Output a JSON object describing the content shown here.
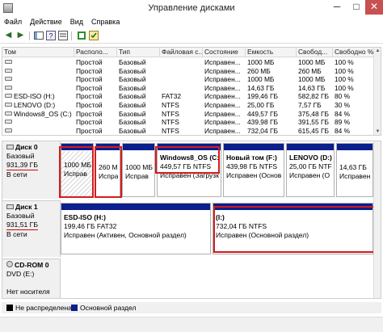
{
  "window": {
    "title": "Управление дисками",
    "min": "─",
    "max": "□",
    "close": "✕"
  },
  "menu": [
    "Файл",
    "Действие",
    "Вид",
    "Справка"
  ],
  "toolbar": {
    "back": "◀",
    "forward": "▶"
  },
  "table": {
    "headers": [
      "Том",
      "Располо...",
      "Тип",
      "Файловая с...",
      "Состояние",
      "Емкость",
      "Свобод...",
      "Свободно %"
    ],
    "rows": [
      [
        "",
        "Простой",
        "Базовый",
        "",
        "Исправен...",
        "1000 МБ",
        "1000 МБ",
        "100 %"
      ],
      [
        "",
        "Простой",
        "Базовый",
        "",
        "Исправен...",
        "260 МБ",
        "260 МБ",
        "100 %"
      ],
      [
        "",
        "Простой",
        "Базовый",
        "",
        "Исправен...",
        "1000 МБ",
        "1000 МБ",
        "100 %"
      ],
      [
        "",
        "Простой",
        "Базовый",
        "",
        "Исправен...",
        "14,63 ГБ",
        "14,63 ГБ",
        "100 %"
      ],
      [
        "ESD-ISO (H:)",
        "Простой",
        "Базовый",
        "FAT32",
        "Исправен...",
        "199,46 ГБ",
        "582,82 ГБ",
        "80 %"
      ],
      [
        "LENOVO (D:)",
        "Простой",
        "Базовый",
        "NTFS",
        "Исправен...",
        "25,00 ГБ",
        "7,57 ГБ",
        "30 %"
      ],
      [
        "Windows8_OS (C:)",
        "Простой",
        "Базовый",
        "NTFS",
        "Исправен...",
        "449,57 ГБ",
        "375,48 ГБ",
        "84 %"
      ],
      [
        "",
        "Простой",
        "Базовый",
        "NTFS",
        "Исправен...",
        "439,98 ГБ",
        "391,55 ГБ",
        "89 %"
      ],
      [
        "",
        "Простой",
        "Базовый",
        "NTFS",
        "Исправен...",
        "732,04 ГБ",
        "615,45 ГБ",
        "84 %"
      ]
    ]
  },
  "disks": [
    {
      "name": "Диск 0",
      "type": "Базовый",
      "size": "931,39 ГБ",
      "status": "В сети",
      "partitions": [
        {
          "line1": "1000 МБ",
          "line2": "Исправ"
        },
        {
          "line1": "260 МІ",
          "line2": "Испра"
        },
        {
          "line1": "1000 МБ",
          "line2": "Исправ"
        },
        {
          "title": "Windows8_OS  (C:)",
          "line1": "449,57 ГБ NTFS",
          "line2": "Исправен (Загрузк"
        },
        {
          "title": "Новый том  (F:)",
          "line1": "439,98 ГБ NTFS",
          "line2": "Исправен (Основ"
        },
        {
          "title": "LENOVO  (D:)",
          "line1": "25,00 ГБ NTFS",
          "line2": "Исправен (О"
        },
        {
          "line1": "14,63 ГБ",
          "line2": "Исправен"
        }
      ]
    },
    {
      "name": "Диск 1",
      "type": "Базовый",
      "size": "931,51 ГБ",
      "status": "В сети",
      "partitions": [
        {
          "title": "ESD-ISO  (H:)",
          "line1": "199,46 ГБ FAT32",
          "line2": "Исправен (Активен, Основной раздел)"
        },
        {
          "title": "(I:)",
          "line1": "732,04 ГБ NTFS",
          "line2": "Исправен (Основной раздел)"
        }
      ]
    },
    {
      "name": "CD-ROM 0",
      "type": "DVD (E:)",
      "size": "",
      "status": "Нет носителя",
      "partitions": []
    }
  ],
  "legend": [
    {
      "label": "Не распределена",
      "color": "#000000"
    },
    {
      "label": "Основной раздел",
      "color": "#0a1e8c"
    }
  ],
  "colors": {
    "partition_bar": "#0a1e8c",
    "highlight": "#d41c1c"
  }
}
